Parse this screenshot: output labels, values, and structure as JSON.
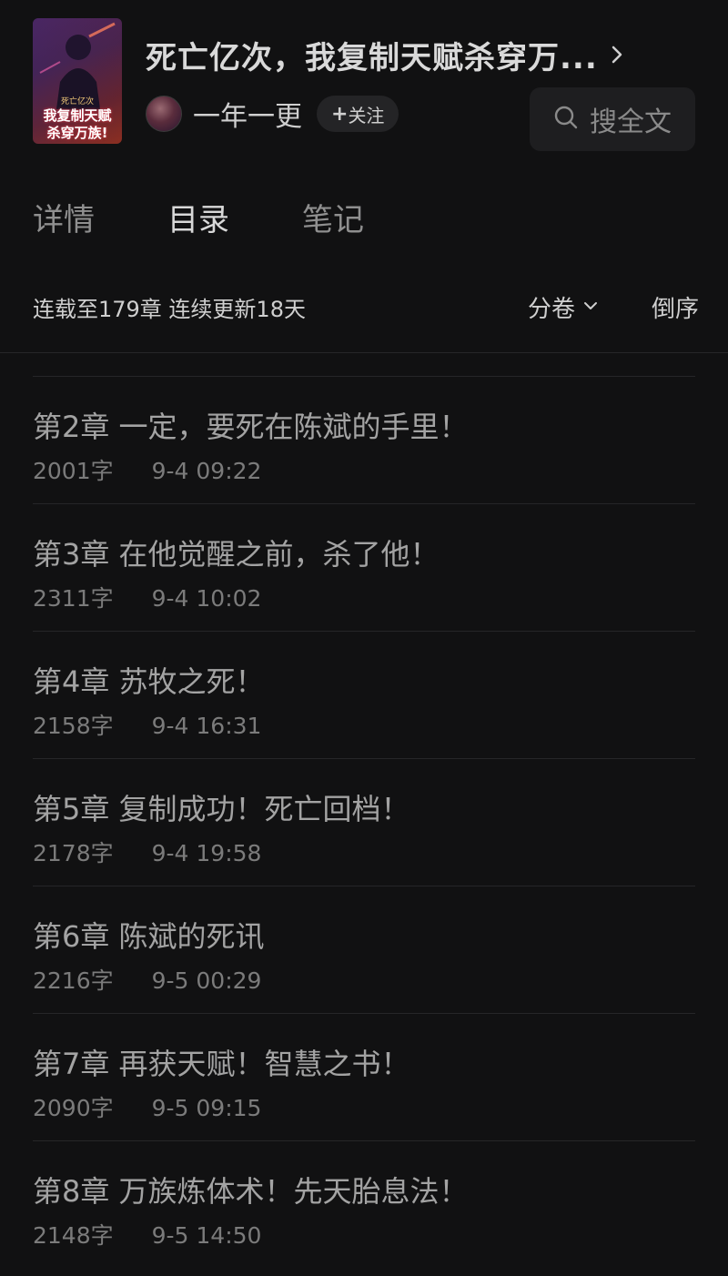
{
  "book": {
    "title": "死亡亿次，我复制天赋杀穿万...",
    "cover_text_top": "死亡亿次",
    "cover_text_main_1": "我复制天赋",
    "cover_text_main_2": "杀穿万族!"
  },
  "author": {
    "name": "一年一更",
    "follow_label": "关注",
    "follow_plus": "+"
  },
  "search": {
    "label": "搜全文"
  },
  "tabs": [
    {
      "label": "详情",
      "active": false
    },
    {
      "label": "目录",
      "active": true
    },
    {
      "label": "笔记",
      "active": false
    }
  ],
  "status": {
    "progress_text": "连载至179章 连续更新18天",
    "volume_label": "分卷",
    "order_label": "倒序"
  },
  "chapters": [
    {
      "title": "第2章 一定，要死在陈斌的手里！",
      "words": "2001字",
      "time": "9-4 09:22"
    },
    {
      "title": "第3章 在他觉醒之前，杀了他！",
      "words": "2311字",
      "time": "9-4 10:02"
    },
    {
      "title": "第4章 苏牧之死！",
      "words": "2158字",
      "time": "9-4 16:31"
    },
    {
      "title": "第5章 复制成功！死亡回档！",
      "words": "2178字",
      "time": "9-4 19:58"
    },
    {
      "title": "第6章 陈斌的死讯",
      "words": "2216字",
      "time": "9-5 00:29"
    },
    {
      "title": "第7章 再获天赋！智慧之书！",
      "words": "2090字",
      "time": "9-5 09:15"
    },
    {
      "title": "第8章 万族炼体术！先天胎息法！",
      "words": "2148字",
      "time": "9-5 14:50"
    }
  ],
  "icons": {
    "chevron_right": "chevron-right-icon",
    "search": "search-icon",
    "chevron_down": "chevron-down-icon"
  }
}
